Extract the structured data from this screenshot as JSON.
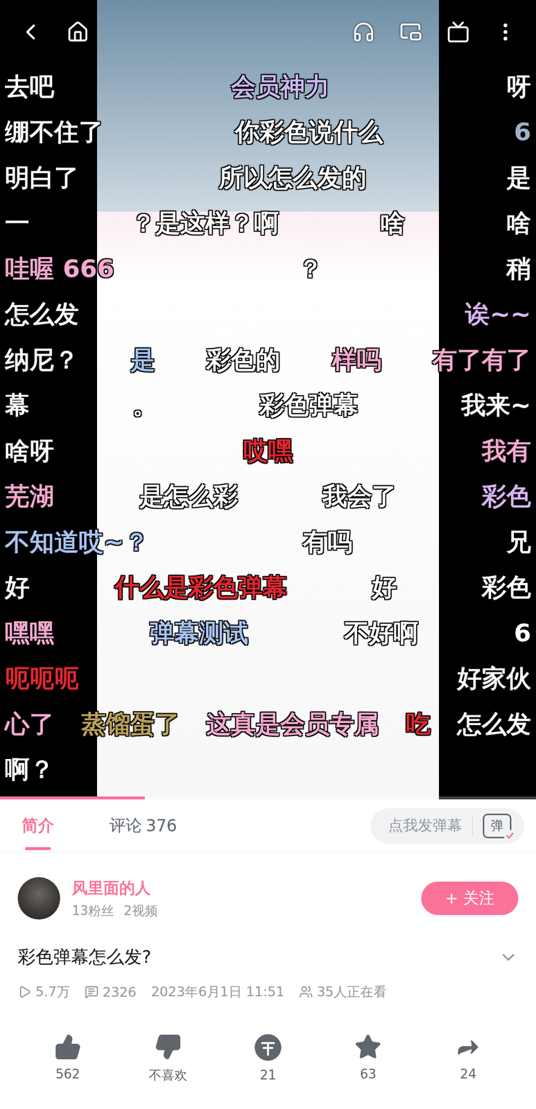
{
  "player": {
    "progress": {
      "level": 0.27
    }
  },
  "danmaku": [
    {
      "items": [
        {
          "text": "去吧",
          "color": "#ffffff"
        },
        {
          "text": "会员神力",
          "color": "#c9b8ef"
        },
        {
          "text": "呀",
          "color": "#ffffff"
        }
      ]
    },
    {
      "items": [
        {
          "text": "绷不住了",
          "color": "#ffffff"
        },
        {
          "text": "你彩色说什么",
          "color": "#ffffff"
        },
        {
          "text": "6",
          "color": "#9fb0c8"
        }
      ]
    },
    {
      "items": [
        {
          "text": "明白了",
          "color": "#ffffff"
        },
        {
          "text": "所以怎么发的",
          "color": "#ffffff"
        },
        {
          "text": "是",
          "color": "#ffffff"
        }
      ]
    },
    {
      "items": [
        {
          "text": "一",
          "color": "#ffffff"
        },
        {
          "text": "？是这样？啊",
          "color": "#ffffff"
        },
        {
          "text": "啥",
          "color": "#ffffff"
        },
        {
          "text": "啥",
          "color": "#ffffff"
        }
      ]
    },
    {
      "items": [
        {
          "text": "哇喔 666",
          "color": "#f3a9cf"
        },
        {
          "text": "？",
          "color": "#ffffff"
        },
        {
          "text": "稍",
          "color": "#ffffff"
        }
      ]
    },
    {
      "items": [
        {
          "text": "怎么发",
          "color": "#ffffff"
        },
        {
          "text": "诶~~",
          "color": "#d9b3ee"
        }
      ]
    },
    {
      "items": [
        {
          "text": "纳尼？",
          "color": "#ffffff"
        },
        {
          "text": "是",
          "color": "#9fc0ee"
        },
        {
          "text": "彩色的",
          "color": "#ffffff"
        },
        {
          "text": "样吗",
          "color": "#f3a9cf"
        },
        {
          "text": "有了有了",
          "color": "#f3a9cf"
        }
      ]
    },
    {
      "items": [
        {
          "text": "幕",
          "color": "#ffffff"
        },
        {
          "text": "。",
          "color": "#ffffff"
        },
        {
          "text": "彩色弹幕",
          "color": "#ffffff"
        },
        {
          "text": "我来~",
          "color": "#ffffff"
        }
      ]
    },
    {
      "items": [
        {
          "text": "啥呀",
          "color": "#ffffff"
        },
        {
          "text": "哎嘿",
          "color": "#e3262f"
        },
        {
          "text": "我有",
          "color": "#f3a9cf"
        }
      ]
    },
    {
      "items": [
        {
          "text": "芜湖",
          "color": "#f3a9cf"
        },
        {
          "text": "是怎么彩",
          "color": "#ffffff"
        },
        {
          "text": "我会了",
          "color": "#ffffff"
        },
        {
          "text": "彩色",
          "color": "#d9b3ee"
        }
      ]
    },
    {
      "items": [
        {
          "text": "不知道哎~？",
          "color": "#a9c2f0"
        },
        {
          "text": "有吗",
          "color": "#ffffff"
        },
        {
          "text": "兄",
          "color": "#ffffff"
        }
      ]
    },
    {
      "items": [
        {
          "text": "好",
          "color": "#ffffff"
        },
        {
          "text": "什么是彩色弹幕",
          "color": "#e3262f"
        },
        {
          "text": "好",
          "color": "#ffffff"
        },
        {
          "text": "彩色",
          "color": "#ffffff"
        }
      ]
    },
    {
      "items": [
        {
          "text": "嘿嘿",
          "color": "#f3a9cf"
        },
        {
          "text": "弹幕测试",
          "color": "#a9c2f0"
        },
        {
          "text": "不好啊",
          "color": "#ffffff"
        },
        {
          "text": "6",
          "color": "#ffffff"
        }
      ]
    },
    {
      "items": [
        {
          "text": "呃呃呃",
          "color": "#e3262f"
        },
        {
          "text": "好家伙",
          "color": "#ffffff"
        }
      ]
    },
    {
      "items": [
        {
          "text": "心了",
          "color": "#f3a9cf"
        },
        {
          "text": "蒸馏蛋了",
          "color": "#b9a25a"
        },
        {
          "text": "这真是会员专属",
          "color": "#f3a9cf"
        },
        {
          "text": "吃",
          "color": "#e3262f"
        },
        {
          "text": "怎么发",
          "color": "#ffffff"
        }
      ]
    },
    {
      "items": [
        {
          "text": "啊？",
          "color": "#ffffff"
        }
      ]
    }
  ],
  "tabs": [
    {
      "label": "简介",
      "count": "",
      "selected": true
    },
    {
      "label": "评论",
      "count": "376",
      "selected": false
    }
  ],
  "danmaku_input": {
    "placeholder": "点我发弹幕",
    "button": "弹"
  },
  "uploader": {
    "name": "风里面的人",
    "fans": "13粉丝",
    "videos": "2视频",
    "follow_icon": "+",
    "follow": "关注"
  },
  "video": {
    "title": "彩色弹幕怎么发?",
    "views": "5.7万",
    "danmaku_count": "2326",
    "date": "2023年6月1日 11:51",
    "watching": "35人正在看"
  },
  "actions": [
    {
      "kind": "like",
      "label": "562"
    },
    {
      "kind": "dislike",
      "label": "不喜欢"
    },
    {
      "kind": "coin",
      "label": "21"
    },
    {
      "kind": "favorite",
      "label": "63"
    },
    {
      "kind": "share",
      "label": "24"
    }
  ]
}
